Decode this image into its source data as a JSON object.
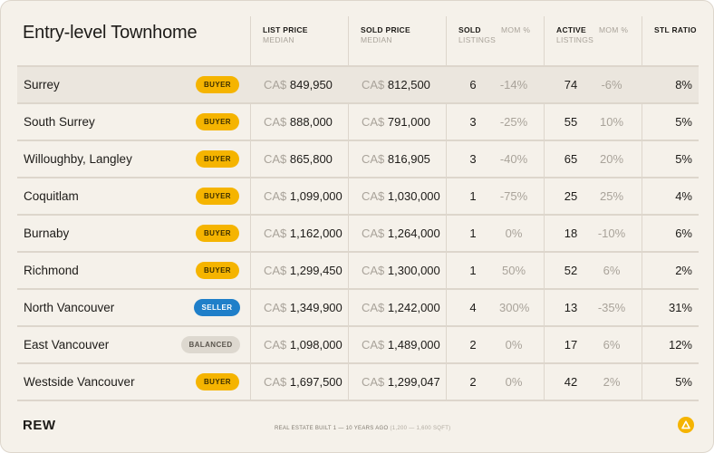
{
  "title": "Entry-level Townhome",
  "headers": {
    "list_price": "LIST PRICE",
    "list_price_sub": "MEDIAN",
    "sold_price": "SOLD PRICE",
    "sold_price_sub": "MEDIAN",
    "sold": "SOLD",
    "sold_sub": "LISTINGS",
    "mom1": "MOM %",
    "active": "ACTIVE",
    "active_sub": "LISTINGS",
    "mom2": "MOM %",
    "stl": "STL RATIO"
  },
  "currency": "CA$",
  "rows": [
    {
      "area": "Surrey",
      "market": "BUYER",
      "list": "849,950",
      "sold_price": "812,500",
      "sold": "6",
      "sold_mom": "-14%",
      "active": "74",
      "active_mom": "-6%",
      "stl": "8%"
    },
    {
      "area": "South Surrey",
      "market": "BUYER",
      "list": "888,000",
      "sold_price": "791,000",
      "sold": "3",
      "sold_mom": "-25%",
      "active": "55",
      "active_mom": "10%",
      "stl": "5%"
    },
    {
      "area": "Willoughby, Langley",
      "market": "BUYER",
      "list": "865,800",
      "sold_price": "816,905",
      "sold": "3",
      "sold_mom": "-40%",
      "active": "65",
      "active_mom": "20%",
      "stl": "5%"
    },
    {
      "area": "Coquitlam",
      "market": "BUYER",
      "list": "1,099,000",
      "sold_price": "1,030,000",
      "sold": "1",
      "sold_mom": "-75%",
      "active": "25",
      "active_mom": "25%",
      "stl": "4%"
    },
    {
      "area": "Burnaby",
      "market": "BUYER",
      "list": "1,162,000",
      "sold_price": "1,264,000",
      "sold": "1",
      "sold_mom": "0%",
      "active": "18",
      "active_mom": "-10%",
      "stl": "6%"
    },
    {
      "area": "Richmond",
      "market": "BUYER",
      "list": "1,299,450",
      "sold_price": "1,300,000",
      "sold": "1",
      "sold_mom": "50%",
      "active": "52",
      "active_mom": "6%",
      "stl": "2%"
    },
    {
      "area": "North Vancouver",
      "market": "SELLER",
      "list": "1,349,900",
      "sold_price": "1,242,000",
      "sold": "4",
      "sold_mom": "300%",
      "active": "13",
      "active_mom": "-35%",
      "stl": "31%"
    },
    {
      "area": "East Vancouver",
      "market": "BALANCED",
      "list": "1,098,000",
      "sold_price": "1,489,000",
      "sold": "2",
      "sold_mom": "0%",
      "active": "17",
      "active_mom": "6%",
      "stl": "12%"
    },
    {
      "area": "Westside Vancouver",
      "market": "BUYER",
      "list": "1,697,500",
      "sold_price": "1,299,047",
      "sold": "2",
      "sold_mom": "0%",
      "active": "42",
      "active_mom": "2%",
      "stl": "5%"
    }
  ],
  "footer": {
    "logo": "REW",
    "note": "REAL ESTATE BUILT 1 — 10 YEARS AGO",
    "note_range": "(1,200 — 1,600 SQFT)"
  },
  "colors": {
    "background": "#f5f1ea",
    "buyer": "#f5b400",
    "seller": "#1f7fc9",
    "balanced": "#ddd8cf"
  },
  "icons": {
    "help": "warning-triangle-icon"
  }
}
